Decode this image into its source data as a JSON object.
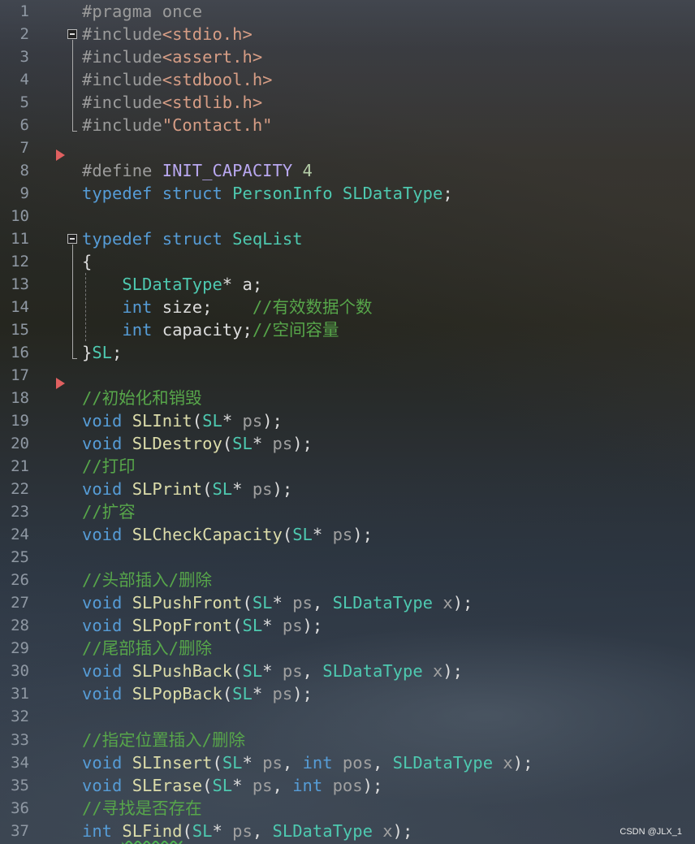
{
  "lines": [
    {
      "n": "1",
      "tokens": [
        {
          "c": "pp",
          "t": "#pragma once"
        }
      ]
    },
    {
      "n": "2",
      "tokens": [
        {
          "c": "pp",
          "t": "#include"
        },
        {
          "c": "str",
          "t": "<stdio.h>"
        }
      ]
    },
    {
      "n": "3",
      "tokens": [
        {
          "c": "pp",
          "t": "#include"
        },
        {
          "c": "str",
          "t": "<assert.h>"
        }
      ]
    },
    {
      "n": "4",
      "tokens": [
        {
          "c": "pp",
          "t": "#include"
        },
        {
          "c": "str",
          "t": "<stdbool.h>"
        }
      ]
    },
    {
      "n": "5",
      "tokens": [
        {
          "c": "pp",
          "t": "#include"
        },
        {
          "c": "str",
          "t": "<stdlib.h>"
        }
      ]
    },
    {
      "n": "6",
      "tokens": [
        {
          "c": "pp",
          "t": "#include"
        },
        {
          "c": "str",
          "t": "\"Contact.h\""
        }
      ]
    },
    {
      "n": "7",
      "tokens": []
    },
    {
      "n": "8",
      "tokens": [
        {
          "c": "pp",
          "t": "#define "
        },
        {
          "c": "macro",
          "t": "INIT_CAPACITY"
        },
        {
          "c": "plain",
          "t": " "
        },
        {
          "c": "num",
          "t": "4"
        }
      ]
    },
    {
      "n": "9",
      "tokens": [
        {
          "c": "kw",
          "t": "typedef struct "
        },
        {
          "c": "type",
          "t": "PersonInfo SLDataType"
        },
        {
          "c": "plain",
          "t": ";"
        }
      ]
    },
    {
      "n": "10",
      "tokens": []
    },
    {
      "n": "11",
      "tokens": [
        {
          "c": "kw",
          "t": "typedef struct "
        },
        {
          "c": "type",
          "t": "SeqList"
        }
      ]
    },
    {
      "n": "12",
      "tokens": [
        {
          "c": "plain",
          "t": "{"
        }
      ]
    },
    {
      "n": "13",
      "tokens": [
        {
          "c": "plain",
          "t": "    "
        },
        {
          "c": "type",
          "t": "SLDataType"
        },
        {
          "c": "plain",
          "t": "* a;"
        }
      ]
    },
    {
      "n": "14",
      "tokens": [
        {
          "c": "plain",
          "t": "    "
        },
        {
          "c": "kw",
          "t": "int"
        },
        {
          "c": "plain",
          "t": " size;    "
        },
        {
          "c": "cmt",
          "t": "//有效数据个数"
        }
      ]
    },
    {
      "n": "15",
      "tokens": [
        {
          "c": "plain",
          "t": "    "
        },
        {
          "c": "kw",
          "t": "int"
        },
        {
          "c": "plain",
          "t": " capacity;"
        },
        {
          "c": "cmt",
          "t": "//空间容量"
        }
      ]
    },
    {
      "n": "16",
      "tokens": [
        {
          "c": "plain",
          "t": "}"
        },
        {
          "c": "type",
          "t": "SL"
        },
        {
          "c": "plain",
          "t": ";"
        }
      ]
    },
    {
      "n": "17",
      "tokens": []
    },
    {
      "n": "18",
      "tokens": [
        {
          "c": "cmt",
          "t": "//初始化和销毁"
        }
      ]
    },
    {
      "n": "19",
      "tokens": [
        {
          "c": "kw",
          "t": "void "
        },
        {
          "c": "fn",
          "t": "SLInit"
        },
        {
          "c": "plain",
          "t": "("
        },
        {
          "c": "type",
          "t": "SL"
        },
        {
          "c": "plain",
          "t": "* "
        },
        {
          "c": "param",
          "t": "ps"
        },
        {
          "c": "plain",
          "t": ");"
        }
      ]
    },
    {
      "n": "20",
      "tokens": [
        {
          "c": "kw",
          "t": "void "
        },
        {
          "c": "fn",
          "t": "SLDestroy"
        },
        {
          "c": "plain",
          "t": "("
        },
        {
          "c": "type",
          "t": "SL"
        },
        {
          "c": "plain",
          "t": "* "
        },
        {
          "c": "param",
          "t": "ps"
        },
        {
          "c": "plain",
          "t": ");"
        }
      ]
    },
    {
      "n": "21",
      "tokens": [
        {
          "c": "cmt",
          "t": "//打印"
        }
      ]
    },
    {
      "n": "22",
      "tokens": [
        {
          "c": "kw",
          "t": "void "
        },
        {
          "c": "fn",
          "t": "SLPrint"
        },
        {
          "c": "plain",
          "t": "("
        },
        {
          "c": "type",
          "t": "SL"
        },
        {
          "c": "plain",
          "t": "* "
        },
        {
          "c": "param",
          "t": "ps"
        },
        {
          "c": "plain",
          "t": ");"
        }
      ]
    },
    {
      "n": "23",
      "tokens": [
        {
          "c": "cmt",
          "t": "//扩容"
        }
      ]
    },
    {
      "n": "24",
      "tokens": [
        {
          "c": "kw",
          "t": "void "
        },
        {
          "c": "fn",
          "t": "SLCheckCapacity"
        },
        {
          "c": "plain",
          "t": "("
        },
        {
          "c": "type",
          "t": "SL"
        },
        {
          "c": "plain",
          "t": "* "
        },
        {
          "c": "param",
          "t": "ps"
        },
        {
          "c": "plain",
          "t": ");"
        }
      ]
    },
    {
      "n": "25",
      "tokens": []
    },
    {
      "n": "26",
      "tokens": [
        {
          "c": "cmt",
          "t": "//头部插入/删除"
        }
      ]
    },
    {
      "n": "27",
      "tokens": [
        {
          "c": "kw",
          "t": "void "
        },
        {
          "c": "fn",
          "t": "SLPushFront"
        },
        {
          "c": "plain",
          "t": "("
        },
        {
          "c": "type",
          "t": "SL"
        },
        {
          "c": "plain",
          "t": "* "
        },
        {
          "c": "param",
          "t": "ps"
        },
        {
          "c": "plain",
          "t": ", "
        },
        {
          "c": "type",
          "t": "SLDataType"
        },
        {
          "c": "param",
          "t": " x"
        },
        {
          "c": "plain",
          "t": ");"
        }
      ]
    },
    {
      "n": "28",
      "tokens": [
        {
          "c": "kw",
          "t": "void "
        },
        {
          "c": "fn",
          "t": "SLPopFront"
        },
        {
          "c": "plain",
          "t": "("
        },
        {
          "c": "type",
          "t": "SL"
        },
        {
          "c": "plain",
          "t": "* "
        },
        {
          "c": "param",
          "t": "ps"
        },
        {
          "c": "plain",
          "t": ");"
        }
      ]
    },
    {
      "n": "29",
      "tokens": [
        {
          "c": "cmt",
          "t": "//尾部插入/删除"
        }
      ]
    },
    {
      "n": "30",
      "tokens": [
        {
          "c": "kw",
          "t": "void "
        },
        {
          "c": "fn",
          "t": "SLPushBack"
        },
        {
          "c": "plain",
          "t": "("
        },
        {
          "c": "type",
          "t": "SL"
        },
        {
          "c": "plain",
          "t": "* "
        },
        {
          "c": "param",
          "t": "ps"
        },
        {
          "c": "plain",
          "t": ", "
        },
        {
          "c": "type",
          "t": "SLDataType"
        },
        {
          "c": "param",
          "t": " x"
        },
        {
          "c": "plain",
          "t": ");"
        }
      ]
    },
    {
      "n": "31",
      "tokens": [
        {
          "c": "kw",
          "t": "void "
        },
        {
          "c": "fn",
          "t": "SLPopBack"
        },
        {
          "c": "plain",
          "t": "("
        },
        {
          "c": "type",
          "t": "SL"
        },
        {
          "c": "plain",
          "t": "* "
        },
        {
          "c": "param",
          "t": "ps"
        },
        {
          "c": "plain",
          "t": ");"
        }
      ]
    },
    {
      "n": "32",
      "tokens": []
    },
    {
      "n": "33",
      "tokens": [
        {
          "c": "cmt",
          "t": "//指定位置插入/删除"
        }
      ]
    },
    {
      "n": "34",
      "tokens": [
        {
          "c": "kw",
          "t": "void "
        },
        {
          "c": "fn",
          "t": "SLInsert"
        },
        {
          "c": "plain",
          "t": "("
        },
        {
          "c": "type",
          "t": "SL"
        },
        {
          "c": "plain",
          "t": "* "
        },
        {
          "c": "param",
          "t": "ps"
        },
        {
          "c": "plain",
          "t": ", "
        },
        {
          "c": "kw",
          "t": "int"
        },
        {
          "c": "param",
          "t": " pos"
        },
        {
          "c": "plain",
          "t": ", "
        },
        {
          "c": "type",
          "t": "SLDataType"
        },
        {
          "c": "param",
          "t": " x"
        },
        {
          "c": "plain",
          "t": ");"
        }
      ]
    },
    {
      "n": "35",
      "tokens": [
        {
          "c": "kw",
          "t": "void "
        },
        {
          "c": "fn",
          "t": "SLErase"
        },
        {
          "c": "plain",
          "t": "("
        },
        {
          "c": "type",
          "t": "SL"
        },
        {
          "c": "plain",
          "t": "* "
        },
        {
          "c": "param",
          "t": "ps"
        },
        {
          "c": "plain",
          "t": ", "
        },
        {
          "c": "kw",
          "t": "int"
        },
        {
          "c": "param",
          "t": " pos"
        },
        {
          "c": "plain",
          "t": ");"
        }
      ]
    },
    {
      "n": "36",
      "tokens": [
        {
          "c": "cmt",
          "t": "//寻找是否存在"
        }
      ]
    },
    {
      "n": "37",
      "tokens": [
        {
          "c": "kw",
          "t": "int "
        },
        {
          "c": "fn squig",
          "t": "SLFind"
        },
        {
          "c": "plain",
          "t": "("
        },
        {
          "c": "type",
          "t": "SL"
        },
        {
          "c": "plain",
          "t": "* "
        },
        {
          "c": "param",
          "t": "ps"
        },
        {
          "c": "plain",
          "t": ", "
        },
        {
          "c": "type",
          "t": "SLDataType"
        },
        {
          "c": "param",
          "t": " x"
        },
        {
          "c": "plain",
          "t": ");"
        }
      ]
    }
  ],
  "breakpoint_lines": [
    8,
    18
  ],
  "fold_regions": [
    [
      2,
      6
    ],
    [
      11,
      16
    ]
  ],
  "colors": {
    "keyword": "#569cd6",
    "type": "#4ec9b0",
    "function": "#dcdcaa",
    "comment": "#57a64a",
    "string": "#d69d85",
    "macro": "#b9a8f0",
    "breakpoint": "#e06060"
  },
  "watermark": "CSDN @JLX_1"
}
